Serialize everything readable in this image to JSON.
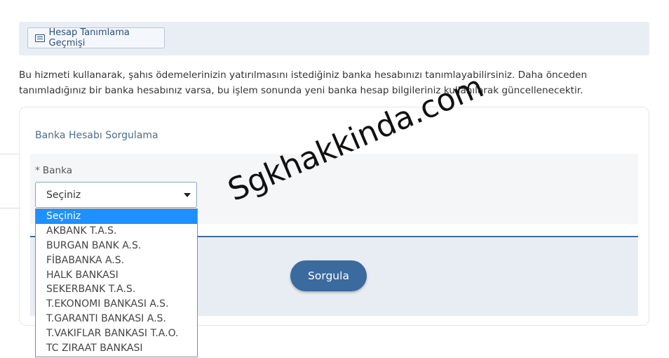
{
  "toolbar": {
    "history_label": "Hesap Tanımlama Geçmişi"
  },
  "intro_text": "Bu hizmeti kullanarak, şahıs ödemelerinizin yatırılmasını istediğiniz banka hesabınızı tanımlayabilirsiniz. Daha önceden tanımladığınız bir banka hesabınız varsa, bu işlem sonunda yeni banka hesap bilgileriniz kullanılarak güncellenecektir.",
  "card": {
    "title": "Banka Hesabı Sorgulama",
    "bank_label": "Banka",
    "required_mark": "*",
    "select_value": "Seçiniz",
    "options": [
      "Seçiniz",
      "AKBANK T.A.S.",
      "BURGAN BANK A.S.",
      "FİBABANKA A.S.",
      "HALK BANKASI",
      "SEKERBANK T.A.S.",
      "T.EKONOMI BANKASI A.S.",
      "T.GARANTI BANKASI A.S.",
      "T.VAKIFLAR BANKASI T.A.O.",
      "TC ZIRAAT BANKASI"
    ],
    "submit_label": "Sorgula"
  },
  "watermark": "Sgkhakkinda.com",
  "colors": {
    "accent": "#3a6a9e",
    "selected_option": "#1e90ff",
    "title": "#4a6e93"
  }
}
